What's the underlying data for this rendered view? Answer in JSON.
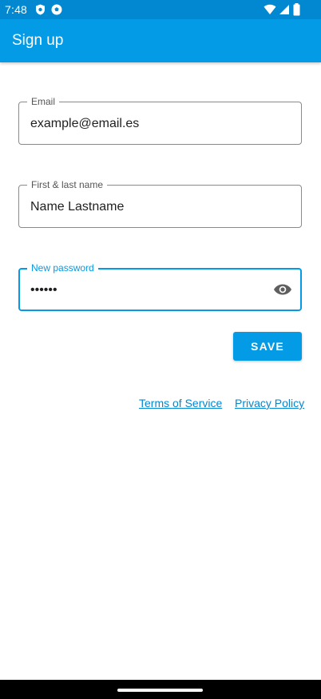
{
  "status_bar": {
    "time": "7:48",
    "left_icons": [
      "shield-icon",
      "soccer-ball-icon"
    ],
    "right_icons": [
      "wifi-icon",
      "signal-icon",
      "battery-icon"
    ]
  },
  "app_bar": {
    "title": "Sign up",
    "color": "#039be5"
  },
  "form": {
    "email": {
      "label": "Email",
      "value": "example@email.es"
    },
    "name": {
      "label": "First & last name",
      "value": "Name Lastname"
    },
    "password": {
      "label": "New password",
      "value": "••••••",
      "focused": true,
      "toggle_icon": "eye-icon"
    },
    "save_label": "SAVE"
  },
  "links": {
    "terms": "Terms of Service",
    "privacy": "Privacy Policy"
  },
  "colors": {
    "accent": "#039be5",
    "status_bar": "#0288d1",
    "link": "#0288d1"
  }
}
